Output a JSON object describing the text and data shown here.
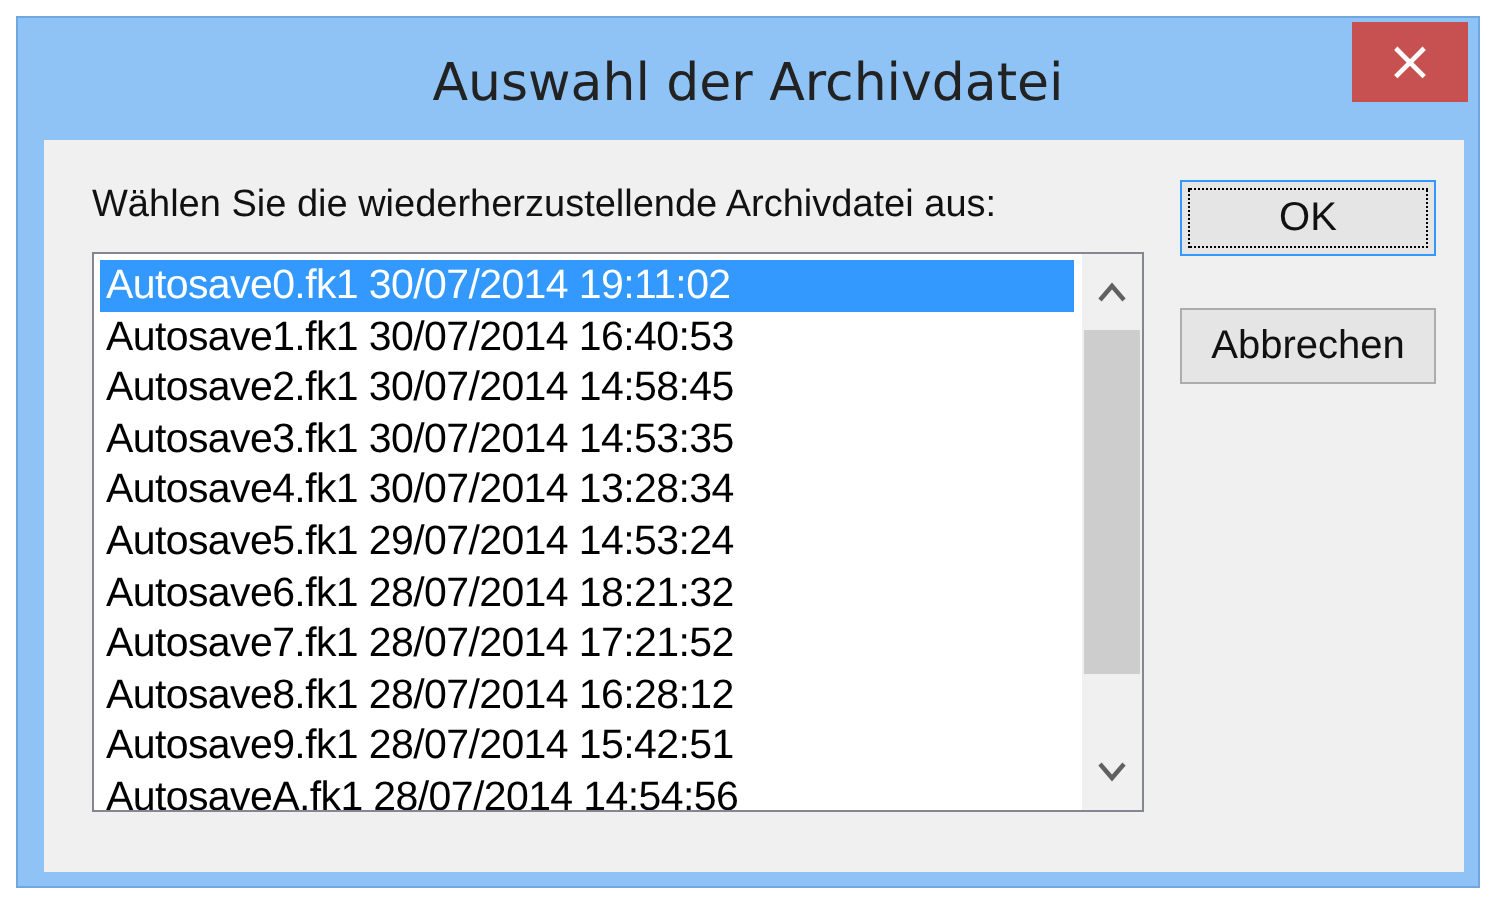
{
  "window": {
    "title": "Auswahl der Archivdatei",
    "close": "×"
  },
  "prompt": "Wählen Sie die wiederherzustellende Archivdatei aus:",
  "files": [
    {
      "label": "Autosave0.fk1 30/07/2014 19:11:02",
      "selected": true
    },
    {
      "label": "Autosave1.fk1 30/07/2014 16:40:53",
      "selected": false
    },
    {
      "label": "Autosave2.fk1 30/07/2014 14:58:45",
      "selected": false
    },
    {
      "label": "Autosave3.fk1 30/07/2014 14:53:35",
      "selected": false
    },
    {
      "label": "Autosave4.fk1 30/07/2014 13:28:34",
      "selected": false
    },
    {
      "label": "Autosave5.fk1 29/07/2014 14:53:24",
      "selected": false
    },
    {
      "label": "Autosave6.fk1 28/07/2014 18:21:32",
      "selected": false
    },
    {
      "label": "Autosave7.fk1 28/07/2014 17:21:52",
      "selected": false
    },
    {
      "label": "Autosave8.fk1 28/07/2014 16:28:12",
      "selected": false
    },
    {
      "label": "Autosave9.fk1 28/07/2014 15:42:51",
      "selected": false
    },
    {
      "label": "AutosaveA.fk1 28/07/2014 14:54:56",
      "selected": false
    }
  ],
  "buttons": [
    {
      "label": "OK",
      "focused": true
    },
    {
      "label": "Abbrechen",
      "focused": false
    }
  ]
}
